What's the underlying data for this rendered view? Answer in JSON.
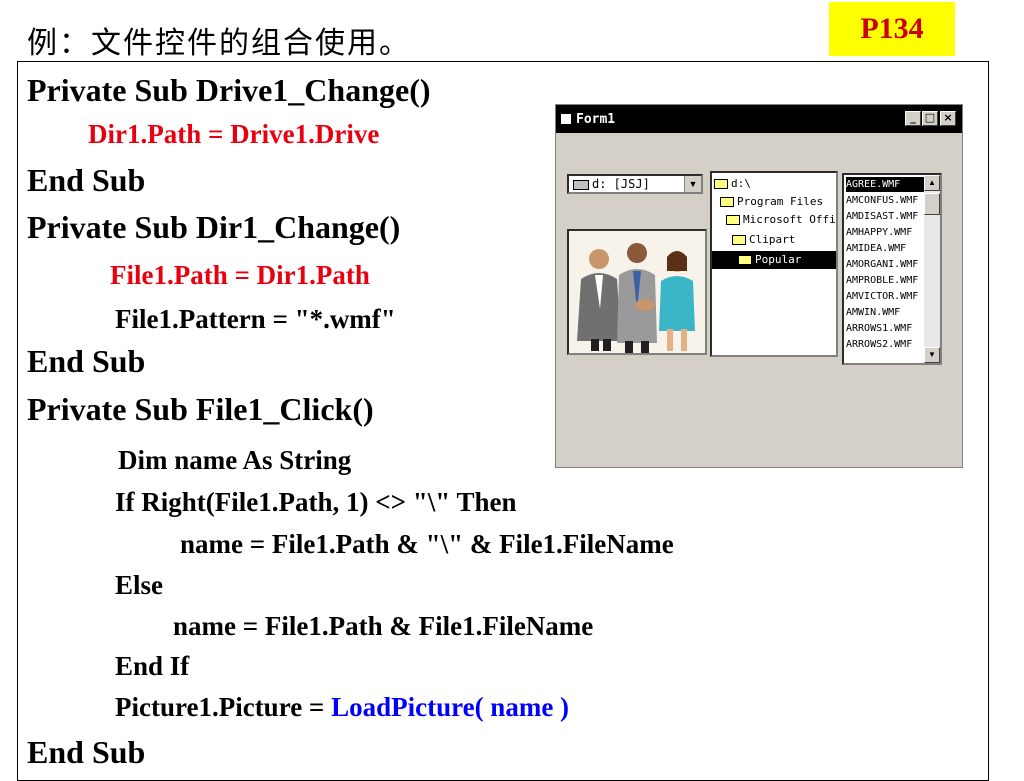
{
  "header": {
    "title": "例：文件控件的组合使用。",
    "page_ref": "P134"
  },
  "code": {
    "lines": [
      "Private Sub Drive1_Change()",
      "Dir1.Path = Drive1.Drive",
      "End Sub",
      "Private Sub Dir1_Change()",
      "File1.Path = Dir1.Path",
      "File1.Pattern = \"*.wmf\"",
      "End Sub",
      "Private Sub File1_Click()",
      "Dim name As String",
      "If Right(File1.Path, 1) <> \"\\\" Then",
      "name = File1.Path & \"\\\" & File1.FileName",
      "Else",
      "name = File1.Path & File1.FileName",
      "End If",
      "Picture1.Picture = ",
      "LoadPicture( name )",
      "End Sub"
    ]
  },
  "colors": {
    "highlight_red": "#e8000e",
    "highlight_blue": "#0000ff",
    "tag_background": "#ffff00",
    "tag_text": "#cc0000"
  },
  "form": {
    "title": "Form1",
    "controls": {
      "minimize": "_",
      "maximize": "□",
      "close": "×"
    },
    "drive": "d: [JSJ]",
    "dirs": [
      "d:\\",
      "Program Files",
      "Microsoft Offi",
      "Clipart",
      "Popular"
    ],
    "files": [
      "AGREE.WMF",
      "AMCONFUS.WMF",
      "AMDISAST.WMF",
      "AMHAPPY.WMF",
      "AMIDEA.WMF",
      "AMORGANI.WMF",
      "AMPROBLE.WMF",
      "AMVICTOR.WMF",
      "AMWIN.WMF",
      "ARROWS1.WMF",
      "ARROWS2.WMF"
    ],
    "scroll_up": "▲",
    "scroll_down": "▼",
    "combo_arrow": "▼"
  }
}
